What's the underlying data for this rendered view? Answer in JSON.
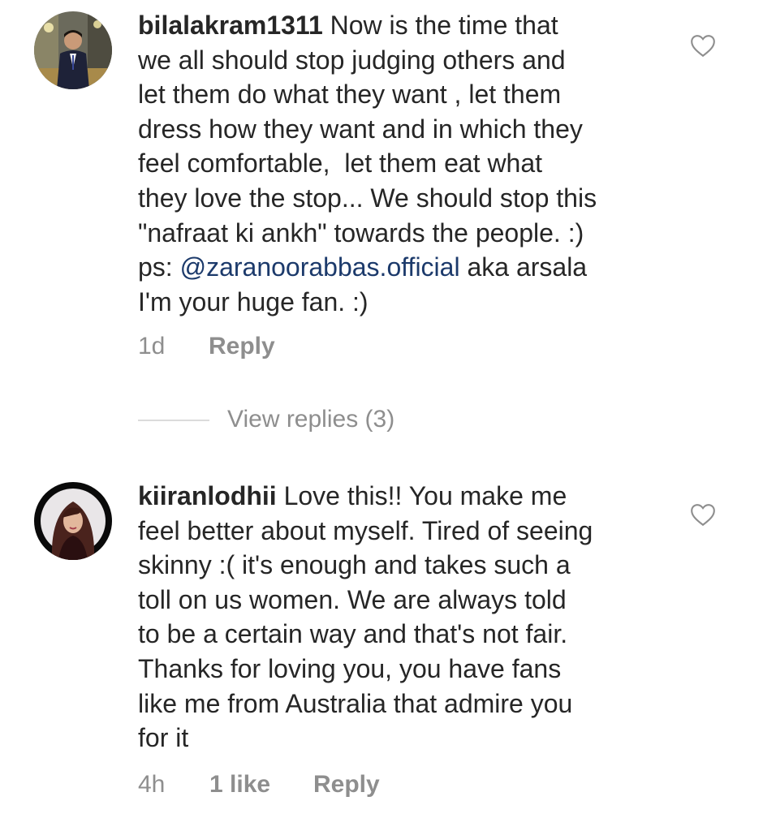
{
  "comments": [
    {
      "username": "bilalakram1311",
      "text_before_mention": " Now is the time that\nwe all should stop judging others and\nlet them do what they want , let them\ndress how they want and in which they\nfeel comfortable,  let them eat what\nthey love the stop... We should stop this\n\"nafraat ki ankh\" towards the people. :)\nps: ",
      "mention": "@zaranoorabbas.official",
      "text_after_mention": " aka arsala\nI'm your huge fan. :)",
      "time": "1d",
      "reply_label": "Reply",
      "view_replies": "View replies (3)",
      "avatar_icon": "avatar-man-suit-icon"
    },
    {
      "username": "kiiranlodhii",
      "text": " Love this!! You make me\nfeel better about myself. Tired of seeing\nskinny :( it's enough and takes such a\ntoll on us women. We are always told\nto be a certain way and that's not fair.\nThanks for loving you, you have fans\nlike me from Australia that admire you\nfor it",
      "time": "4h",
      "likes": "1 like",
      "reply_label": "Reply",
      "avatar_icon": "avatar-woman-icon"
    }
  ],
  "colors": {
    "text": "#262626",
    "meta": "#8e8e8e",
    "mention": "#1c3a6b",
    "divider": "#dbdbdb"
  }
}
